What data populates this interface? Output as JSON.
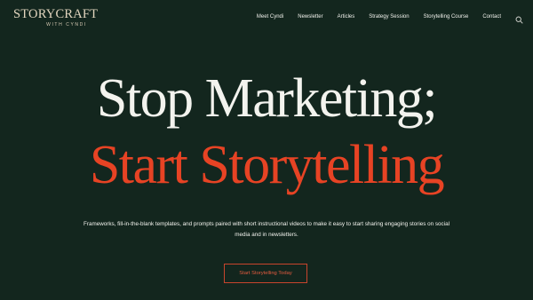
{
  "logo": {
    "main": "STORYCRAFT",
    "sub": "WITH CYNDI"
  },
  "nav": {
    "items": [
      {
        "label": "Meet Cyndi"
      },
      {
        "label": "Newsletter"
      },
      {
        "label": "Articles"
      },
      {
        "label": "Strategy Session"
      },
      {
        "label": "Storytelling Course"
      },
      {
        "label": "Contact"
      }
    ],
    "search_icon": "search-icon"
  },
  "hero": {
    "line1": "Stop Marketing;",
    "line2": "Start Storytelling",
    "subtitle": "Frameworks, fill-in-the-blank templates, and prompts paired with short instructional videos to make it easy to start sharing engaging stories on social media and in newsletters.",
    "cta_label": "Start Storytelling Today"
  },
  "colors": {
    "background": "#13261e",
    "accent": "#e74324",
    "text": "#f3f3ee",
    "logo": "#e3d6bf"
  }
}
